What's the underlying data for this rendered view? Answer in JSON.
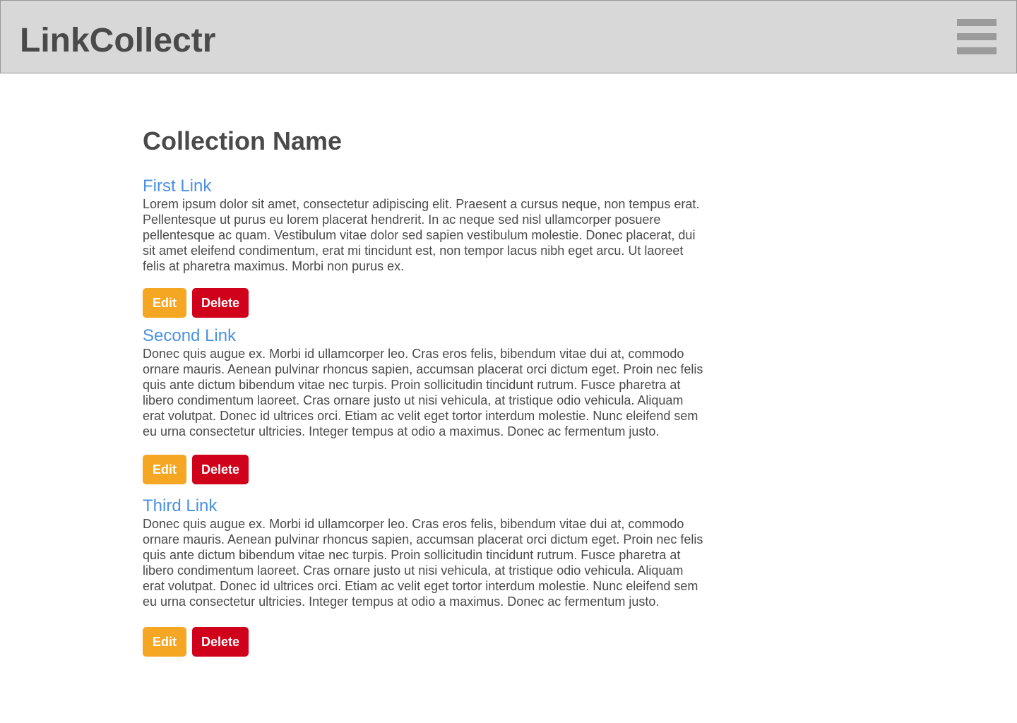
{
  "header": {
    "brand": "LinkCollectr",
    "menu_icon": "hamburger-menu-icon"
  },
  "collection": {
    "title": "Collection Name"
  },
  "links": [
    {
      "title": "First Link",
      "description": "Lorem ipsum dolor sit amet, consectetur adipiscing elit. Praesent a cursus neque, non tempus erat. Pellentesque ut purus eu lorem placerat hendrerit. In ac neque sed nisl ullamcorper posuere pellentesque ac quam. Vestibulum vitae dolor sed sapien vestibulum molestie. Donec placerat, dui sit amet eleifend condimentum, erat mi tincidunt est, non tempor lacus nibh eget arcu. Ut laoreet felis at pharetra maximus. Morbi non purus ex.",
      "edit_label": "Edit",
      "delete_label": "Delete"
    },
    {
      "title": "Second Link",
      "description": "Donec quis augue ex. Morbi id ullamcorper leo. Cras eros felis, bibendum vitae dui at, commodo ornare mauris. Aenean pulvinar rhoncus sapien, accumsan placerat orci dictum eget. Proin nec felis quis ante dictum bibendum vitae nec turpis. Proin sollicitudin tincidunt rutrum. Fusce pharetra at libero condimentum laoreet. Cras ornare justo ut nisi vehicula, at tristique odio vehicula. Aliquam erat volutpat. Donec id ultrices orci. Etiam ac velit eget tortor interdum molestie. Nunc eleifend sem eu urna consectetur ultricies. Integer tempus at odio a maximus. Donec ac fermentum justo.",
      "edit_label": "Edit",
      "delete_label": "Delete"
    },
    {
      "title": "Third Link",
      "description": "Donec quis augue ex. Morbi id ullamcorper leo. Cras eros felis, bibendum vitae dui at, commodo ornare mauris. Aenean pulvinar rhoncus sapien, accumsan placerat orci dictum eget. Proin nec felis quis ante dictum bibendum vitae nec turpis. Proin sollicitudin tincidunt rutrum. Fusce pharetra at libero condimentum laoreet. Cras ornare justo ut nisi vehicula, at tristique odio vehicula. Aliquam erat volutpat. Donec id ultrices orci. Etiam ac velit eget tortor interdum molestie. Nunc eleifend sem eu urna consectetur ultricies. Integer tempus at odio a maximus. Donec ac fermentum justo.",
      "edit_label": "Edit",
      "delete_label": "Delete"
    }
  ],
  "colors": {
    "header_bg": "#d8d8d8",
    "text": "#4a4a4a",
    "link": "#4a90e2",
    "edit_button": "#f5a623",
    "delete_button": "#d0021b",
    "menu_icon": "#9b9b9b"
  }
}
